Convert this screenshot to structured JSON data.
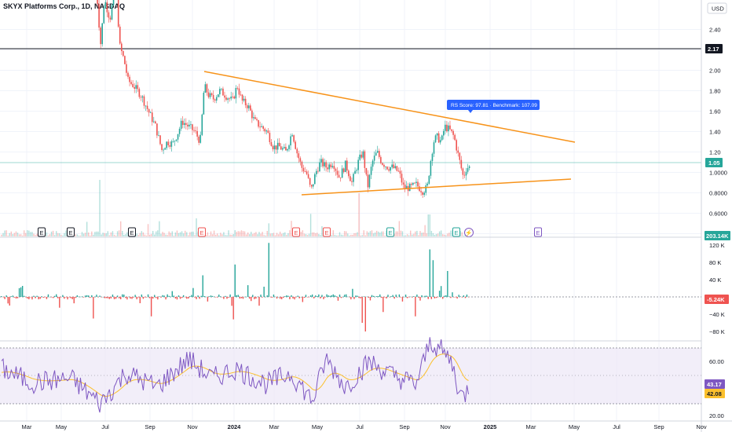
{
  "header": {
    "title": "SKYX Platforms Corp., 1D, NASDAQ"
  },
  "currency_button": "USD",
  "colors": {
    "up": "#26a69a",
    "down": "#ef5350",
    "trendline": "#f7931a",
    "tooltip": "#2962ff",
    "rsi_line": "#7e57c2",
    "rsi_ma": "#fbc02d",
    "rsi_band": "#ede7f6"
  },
  "main_axis": {
    "ticks": [
      "2.40",
      "2.20",
      "2.00",
      "1.80",
      "1.60",
      "1.40",
      "1.20",
      "1.0000",
      "0.8000",
      "0.6000",
      "0.4000"
    ]
  },
  "volume_axis": {
    "ticks": [
      "120 K",
      "80 K",
      "40 K",
      "0",
      "−40 K",
      "−80 K"
    ]
  },
  "rsi_axis": {
    "ticks": [
      "60.00",
      "20.00"
    ]
  },
  "badges": {
    "horizontal_line": "2.17",
    "last_price": "1.05",
    "volume": "203.14K",
    "volume_delta": "-5.24K",
    "rsi": "43.17",
    "rsi_ma": "42.08"
  },
  "tooltip": {
    "text": "RS Score: 97.81   ·   Benchmark: 107.09"
  },
  "earnings_markers": [
    {
      "label": "E",
      "kind": "neutral"
    },
    {
      "label": "E",
      "kind": "neutral"
    },
    {
      "label": "E",
      "kind": "neutral"
    },
    {
      "label": "E",
      "kind": "miss"
    },
    {
      "label": "E",
      "kind": "miss"
    },
    {
      "label": "E",
      "kind": "miss"
    },
    {
      "label": "E",
      "kind": "beat"
    },
    {
      "label": "E",
      "kind": "beat"
    },
    {
      "label": "⚡",
      "kind": "event"
    },
    {
      "label": "E",
      "kind": "upcoming"
    }
  ],
  "time_axis": {
    "labels": [
      "Mar",
      "May",
      "Jul",
      "Sep",
      "Nov",
      "2024",
      "Mar",
      "May",
      "Jul",
      "Sep",
      "Nov",
      "2025",
      "Mar",
      "May",
      "Jul",
      "Sep",
      "Nov"
    ]
  },
  "chart_data": [
    {
      "type": "candlestick",
      "title": "SKYX Platforms Corp., 1D, NASDAQ",
      "ylim": [
        0.4,
        2.55
      ],
      "x": [
        "Mar",
        "May",
        "Jul",
        "Sep",
        "Nov",
        "2024",
        "Mar",
        "May",
        "Jul",
        "Sep",
        "Nov"
      ],
      "close_approx": [
        3.1,
        2.9,
        2.3,
        1.25,
        1.85,
        1.75,
        1.25,
        0.9,
        0.95,
        0.85,
        1.05
      ],
      "last_price": 1.05,
      "horizontal_level": 2.17,
      "trendlines": [
        {
          "from": [
            "Nov 2023",
            1.94
          ],
          "to": [
            "May 2025",
            1.25
          ]
        },
        {
          "from": [
            "Apr 2024",
            0.72
          ],
          "to": [
            "May 2025",
            0.88
          ]
        }
      ]
    },
    {
      "type": "bar",
      "title": "",
      "last_value": "203.14K"
    },
    {
      "type": "bar",
      "title": "",
      "ylim": [
        -80000,
        120000
      ],
      "last_value": "-5.24K"
    },
    {
      "type": "line",
      "title": "",
      "ylim": [
        20,
        80
      ],
      "series": [
        {
          "values": [
            55,
            48,
            40,
            52,
            45,
            38,
            50,
            60,
            44,
            40,
            66,
            43.17
          ]
        },
        {
          "values": [
            52,
            47,
            44,
            48,
            45,
            42,
            47,
            55,
            47,
            44,
            58,
            42.08
          ]
        }
      ]
    }
  ]
}
